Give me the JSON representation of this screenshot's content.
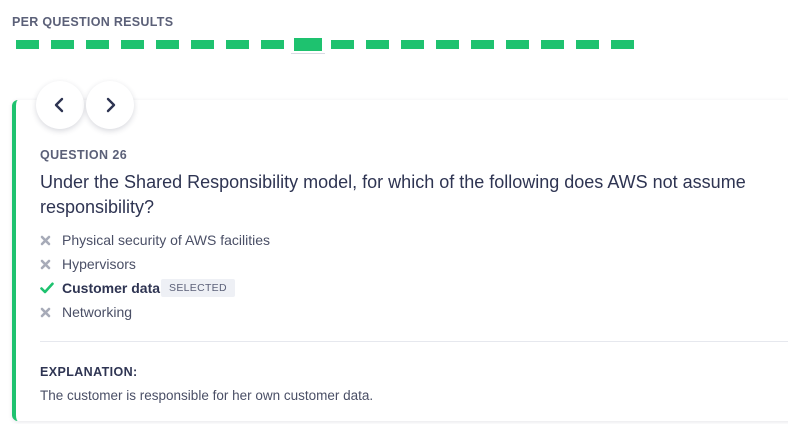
{
  "header": {
    "title": "PER QUESTION RESULTS"
  },
  "progress": {
    "total_segments": 18,
    "current_index": 8,
    "status_color": "#1ec26f"
  },
  "question": {
    "number_label": "QUESTION 26",
    "text": "Under the Shared Responsibility model, for which of the following does AWS not assume responsibility?",
    "answers": [
      {
        "label": "Physical security of AWS facilities",
        "icon": "cross-icon",
        "correct": false,
        "selected": false
      },
      {
        "label": "Hypervisors",
        "icon": "cross-icon",
        "correct": false,
        "selected": false
      },
      {
        "label": "Customer data",
        "icon": "check-icon",
        "correct": true,
        "selected": true,
        "badge": "SELECTED"
      },
      {
        "label": "Networking",
        "icon": "cross-icon",
        "correct": false,
        "selected": false
      }
    ]
  },
  "explanation": {
    "label": "EXPLANATION:",
    "text": "The customer is responsible for her own customer data."
  },
  "navigation": {
    "prev_icon": "chevron-left-icon",
    "next_icon": "chevron-right-icon"
  },
  "colors": {
    "accent_green": "#1ec26f",
    "text_dark": "#2e3452",
    "cross_gray": "#a7abb8"
  }
}
